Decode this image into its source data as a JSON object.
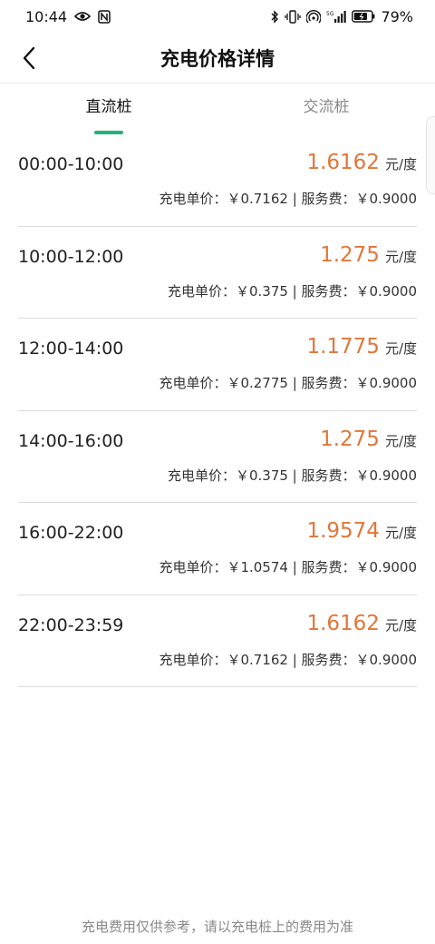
{
  "status_bar": {
    "time": "10:44",
    "left_icons": [
      "eye-icon",
      "nfc-icon"
    ],
    "right_icons": [
      "bluetooth-icon",
      "vibrate-icon",
      "hotspot-icon",
      "signal-5g-icon",
      "battery-icon"
    ],
    "battery_percent": "79%",
    "battery_level": 0.79
  },
  "header": {
    "title": "充电价格详情",
    "back_icon": "chevron-left-icon"
  },
  "tabs": {
    "items": [
      {
        "label": "直流桩",
        "active": true
      },
      {
        "label": "交流桩",
        "active": false
      }
    ],
    "accent_color": "#1fb57a"
  },
  "price_rows": [
    {
      "time": "00:00-10:00",
      "total": "1.6162",
      "unit": "元/度",
      "breakdown": "充电单价：￥0.7162 | 服务费：￥0.9000"
    },
    {
      "time": "10:00-12:00",
      "total": "1.275",
      "unit": "元/度",
      "breakdown": "充电单价：￥0.375 | 服务费：￥0.9000"
    },
    {
      "time": "12:00-14:00",
      "total": "1.1775",
      "unit": "元/度",
      "breakdown": "充电单价：￥0.2775 | 服务费：￥0.9000"
    },
    {
      "time": "14:00-16:00",
      "total": "1.275",
      "unit": "元/度",
      "breakdown": "充电单价：￥0.375 | 服务费：￥0.9000"
    },
    {
      "time": "16:00-22:00",
      "total": "1.9574",
      "unit": "元/度",
      "breakdown": "充电单价：￥1.0574 | 服务费：￥0.9000"
    },
    {
      "time": "22:00-23:59",
      "total": "1.6162",
      "unit": "元/度",
      "breakdown": "充电单价：￥0.7162 | 服务费：￥0.9000"
    }
  ],
  "price_color": "#e0773a",
  "footer": {
    "note": "充电费用仅供参考，请以充电桩上的费用为准"
  }
}
